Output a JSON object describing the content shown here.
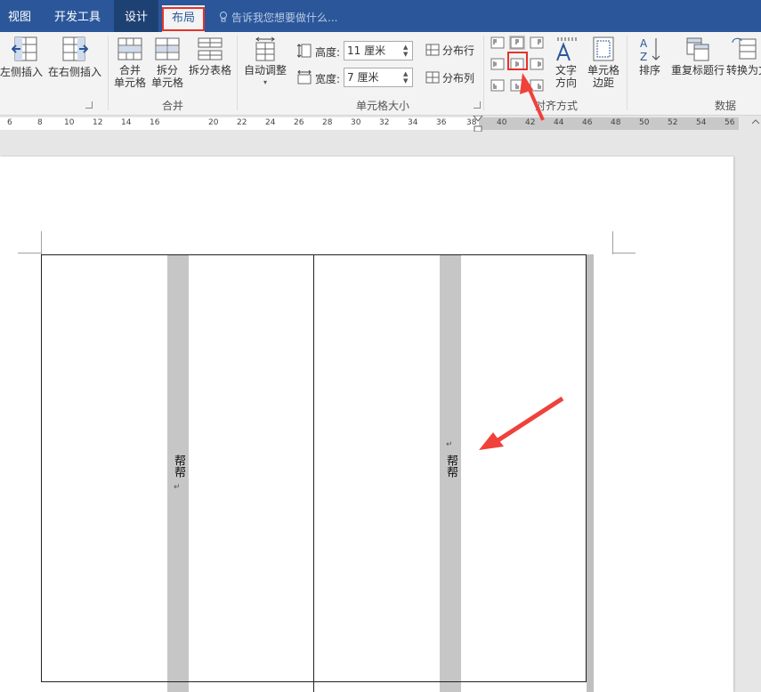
{
  "tabs": {
    "view": "视图",
    "developer": "开发工具",
    "design": "设计",
    "layout": "布局",
    "tellme": "告诉我您想要做什么..."
  },
  "ribbon": {
    "insert_left": "左侧插入",
    "insert_right": "在右侧插入",
    "merge_cells": [
      "合并",
      "单元格"
    ],
    "split_cells": [
      "拆分",
      "单元格"
    ],
    "split_table": "拆分表格",
    "autofit": "自动调整",
    "merge_group": "合并",
    "height_label": "高度:",
    "height_value": "11 厘米",
    "width_label": "宽度:",
    "width_value": "7 厘米",
    "distribute_rows": "分布行",
    "distribute_cols": "分布列",
    "cell_size_group": "单元格大小",
    "text_direction": [
      "文字",
      "方向"
    ],
    "cell_margins": [
      "单元格",
      "边距"
    ],
    "alignment_group": "对齐方式",
    "sort": "排序",
    "repeat_header": "重复标题行",
    "convert_text": "转换为文",
    "data_group": "数据"
  },
  "ruler": {
    "numbers": [
      "6",
      "8",
      "10",
      "12",
      "14",
      "16",
      "20",
      "22",
      "24",
      "26",
      "28",
      "30",
      "32",
      "34",
      "36",
      "38",
      "40",
      "42",
      "44",
      "46",
      "48",
      "50",
      "52",
      "54",
      "56"
    ]
  },
  "document": {
    "cell1_text": "帮帮",
    "cell2_text": "帮帮"
  },
  "colors": {
    "tab_bar": "#2b579a",
    "highlight": "#e5322d",
    "arrow": "#f0413b"
  }
}
